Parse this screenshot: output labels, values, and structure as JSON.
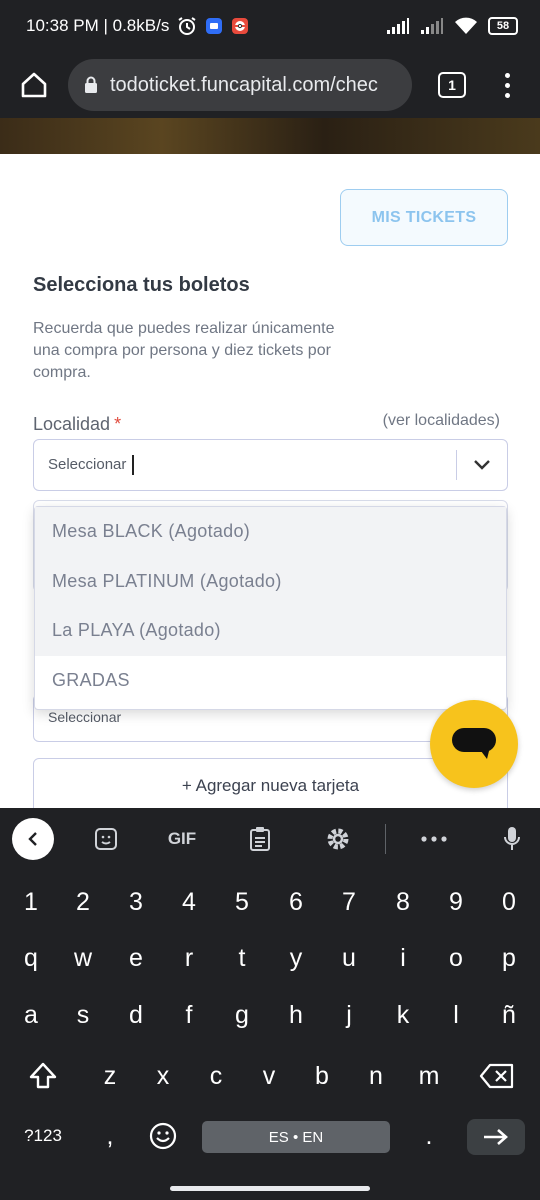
{
  "status_bar": {
    "time_speed": "10:38 PM | 0.8kB/s",
    "battery": "58"
  },
  "browser": {
    "url": "todoticket.funcapital.com/chec",
    "tab_count": "1"
  },
  "page": {
    "mis_tickets_label": "MIS TICKETS",
    "title": "Selecciona tus boletos",
    "description": "Recuerda que puedes realizar únicamente una compra por persona y diez tickets por compra.",
    "localidad_label": "Localidad",
    "required_mark": "*",
    "ver_localidades": "(ver localidades)",
    "select_placeholder": "Seleccionar",
    "second_select_placeholder": "Seleccionar",
    "add_card_label": "+ Agregar nueva tarjeta",
    "dropdown_options": [
      {
        "label": "Mesa BLACK (Agotado)",
        "disabled": true
      },
      {
        "label": "Mesa PLATINUM (Agotado)",
        "disabled": true
      },
      {
        "label": "La PLAYA (Agotado)",
        "disabled": true
      },
      {
        "label": "GRADAS",
        "disabled": false
      }
    ]
  },
  "keyboard": {
    "toolbar_gif": "GIF",
    "row_numbers": [
      "1",
      "2",
      "3",
      "4",
      "5",
      "6",
      "7",
      "8",
      "9",
      "0"
    ],
    "row_1": [
      "q",
      "w",
      "e",
      "r",
      "t",
      "y",
      "u",
      "i",
      "o",
      "p"
    ],
    "row_2": [
      "a",
      "s",
      "d",
      "f",
      "g",
      "h",
      "j",
      "k",
      "l",
      "ñ"
    ],
    "row_3": [
      "z",
      "x",
      "c",
      "v",
      "b",
      "n",
      "m"
    ],
    "symbols_key": "?123",
    "comma_key": ",",
    "period_key": ".",
    "space_label": "ES • EN"
  },
  "colors": {
    "accent_blue": "#8cc4ee",
    "chat_yellow": "#f7c31c",
    "required_red": "#e04a3c"
  }
}
